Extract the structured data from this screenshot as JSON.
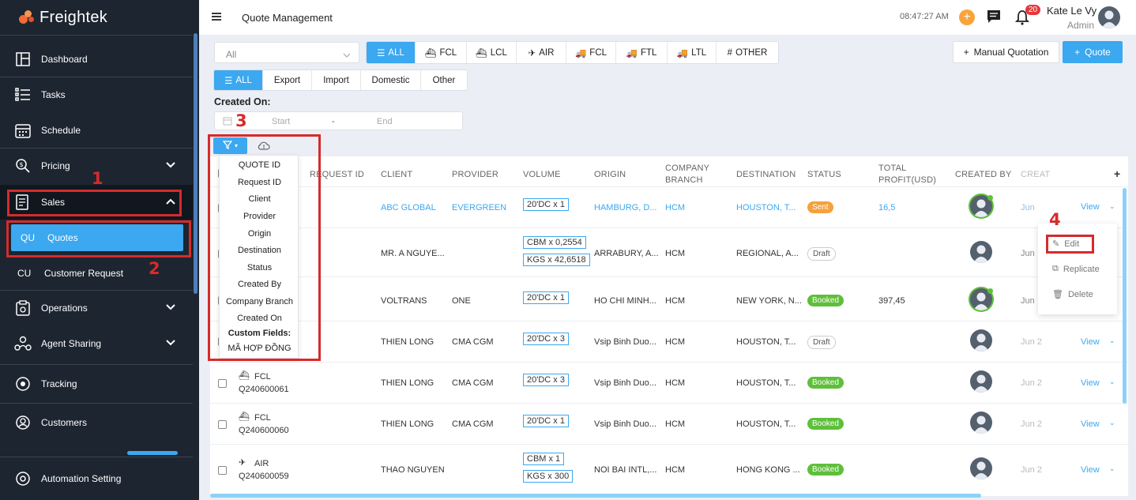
{
  "app": {
    "brand": "Freightek",
    "page_title": "Quote Management"
  },
  "sidebar": {
    "items": [
      {
        "label": "Dashboard",
        "icon": "dashboard-icon"
      },
      {
        "label": "Tasks",
        "icon": "tasks-icon"
      },
      {
        "label": "Schedule",
        "icon": "calendar-icon"
      },
      {
        "label": "Pricing",
        "icon": "pricing-icon"
      },
      {
        "label": "Sales",
        "icon": "sales-icon"
      },
      {
        "label": "Quotes",
        "abbr": "QU"
      },
      {
        "label": "Customer Request",
        "abbr": "CU"
      },
      {
        "label": "Operations",
        "icon": "operations-icon"
      },
      {
        "label": "Agent Sharing",
        "icon": "agent-sharing-icon"
      },
      {
        "label": "Tracking",
        "icon": "tracking-icon"
      },
      {
        "label": "Customers",
        "icon": "customers-icon"
      },
      {
        "label": "Automation Setting",
        "icon": "settings-icon"
      }
    ]
  },
  "header": {
    "time": "08:47:27 AM",
    "notifications": "20",
    "user_name": "Kate Le Vy",
    "user_role": "Admin"
  },
  "filters": {
    "select_value": "All",
    "modes": [
      "ALL",
      "FCL",
      "LCL",
      "AIR",
      "FCL",
      "FTL",
      "LTL",
      "OTHER"
    ],
    "directions": [
      "ALL",
      "Export",
      "Import",
      "Domestic",
      "Other"
    ],
    "created_on_label": "Created On:",
    "start_placeholder": "Start",
    "end_placeholder": "End",
    "range_sep": "-"
  },
  "actions": {
    "manual": "Manual Quotation",
    "quote": "Quote"
  },
  "table": {
    "headers": [
      "REQUEST ID",
      "CLIENT",
      "PROVIDER",
      "VOLUME",
      "ORIGIN",
      "COMPANY BRANCH",
      "DESTINATION",
      "STATUS",
      "TOTAL PROFIT(USD)",
      "CREATED BY",
      "CREAT"
    ],
    "rows": [
      {
        "client": "ABC GLOBAL",
        "provider": "EVERGREEN",
        "volume": [
          "20'DC x 1"
        ],
        "origin": "HAMBURG, D...",
        "branch": "HCM",
        "destination": "HOUSTON, T...",
        "status": "Sent",
        "profit": "16,5",
        "created": "Jun",
        "view": "View"
      },
      {
        "client": "MR. A NGUYE...",
        "provider": "",
        "volume": [
          "CBM x 0,2554",
          "KGS x 42,6518"
        ],
        "origin": "ARRABURY, A...",
        "branch": "HCM",
        "destination": "REGIONAL, A...",
        "status": "Draft",
        "profit": "",
        "created": "Jun",
        "view": ""
      },
      {
        "client": "VOLTRANS",
        "provider": "ONE",
        "volume": [
          "20'DC x 1"
        ],
        "origin": "HO CHI MINH...",
        "branch": "HCM",
        "destination": "NEW YORK, N...",
        "status": "Booked",
        "profit": "397,45",
        "created": "Jun",
        "view": ""
      },
      {
        "client": "THIEN LONG",
        "provider": "CMA CGM",
        "volume": [
          "20'DC x 3"
        ],
        "origin": "Vsip Binh Duo...",
        "branch": "HCM",
        "destination": "HOUSTON, T...",
        "status": "Draft",
        "profit": "",
        "created": "Jun 2",
        "view": "View"
      },
      {
        "mode": "FCL",
        "id": "Q240600061",
        "client": "THIEN LONG",
        "provider": "CMA CGM",
        "volume": [
          "20'DC x 3"
        ],
        "origin": "Vsip Binh Duo...",
        "branch": "HCM",
        "destination": "HOUSTON, T...",
        "status": "Booked",
        "profit": "",
        "created": "Jun 2",
        "view": "View"
      },
      {
        "mode": "FCL",
        "id": "Q240600060",
        "client": "THIEN LONG",
        "provider": "CMA CGM",
        "volume": [
          "20'DC x 1"
        ],
        "origin": "Vsip Binh Duo...",
        "branch": "HCM",
        "destination": "HOUSTON, T...",
        "status": "Booked",
        "profit": "",
        "created": "Jun 2",
        "view": "View"
      },
      {
        "mode": "AIR",
        "id": "Q240600059",
        "client": "THAO NGUYEN",
        "provider": "",
        "volume": [
          "CBM x 1",
          "KGS x 300"
        ],
        "origin": "NOI BAI INTL,...",
        "branch": "HCM",
        "destination": "HONG KONG ...",
        "status": "Booked",
        "profit": "",
        "created": "Jun 2",
        "view": "View"
      }
    ]
  },
  "filter_menu": [
    "QUOTE ID",
    "Request ID",
    "Client",
    "Provider",
    "Origin",
    "Destination",
    "Status",
    "Created By",
    "Company Branch",
    "Created On",
    "Custom Fields:",
    "MÃ HỢP ĐỒNG"
  ],
  "row_menu": [
    "Edit",
    "Replicate",
    "Delete"
  ],
  "annotations": [
    "1",
    "2",
    "3",
    "4"
  ],
  "colors": {
    "sidebar": "#1d2530",
    "accent": "#3ba8f0",
    "highlight": "#d62b2b"
  }
}
